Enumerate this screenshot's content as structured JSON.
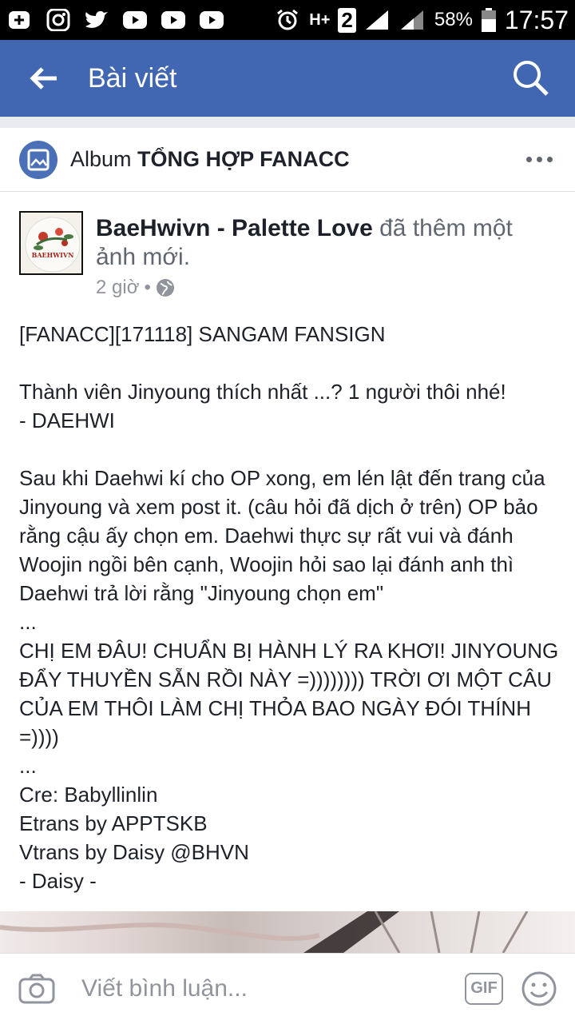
{
  "status_bar": {
    "icons_left": [
      "plus-badge-icon",
      "instagram-icon",
      "twitter-icon",
      "youtube-icon",
      "youtube-icon",
      "youtube-icon"
    ],
    "network": "H+",
    "sim_number": "2",
    "battery": "58%",
    "time": "17:57"
  },
  "app_bar": {
    "title": "Bài viết"
  },
  "album": {
    "prefix": "Album",
    "name": "TỔNG HỢP FANACC"
  },
  "post": {
    "author": "BaeHwivn - Palette Love",
    "action": "đã thêm một ảnh mới.",
    "time": "2 giờ",
    "separator": "•",
    "avatar_text": "BAEHWIVN",
    "body": [
      "[FANACC][171118] SANGAM FANSIGN",
      "",
      "Thành viên Jinyoung thích nhất ...? 1 người thôi nhé!\n- DAEHWI",
      "",
      "Sau khi Daehwi kí cho OP xong, em lén lật đến trang của Jinyoung và xem post it. (câu hỏi đã dịch ở trên) OP bảo rằng cậu ấy chọn em. Daehwi thực sự rất vui và đánh Woojin ngồi bên cạnh, Woojin hỏi sao lại đánh anh thì Daehwi trả lời rằng \"Jinyoung chọn em\"\n...\nCHỊ EM ĐÂU! CHUẨN BỊ HÀNH LÝ RA KHƠI! JINYOUNG ĐẨY THUYỀN SẴN RỒI NÀY =)))))))) TRỜI ƠI MỘT CÂU CỦA EM THÔI LÀM CHỊ THỎA BAO NGÀY ĐÓI THÍNH =))))\n...\nCre: Babyllinlin\nEtrans by APPTSKB\nVtrans by Daisy @BHVN\n- Daisy -"
    ]
  },
  "composer": {
    "placeholder": "Viết bình luận...",
    "gif_label": "GIF"
  },
  "colors": {
    "brand": "#4267b2",
    "text": "#1d2129",
    "muted": "#90949c"
  }
}
